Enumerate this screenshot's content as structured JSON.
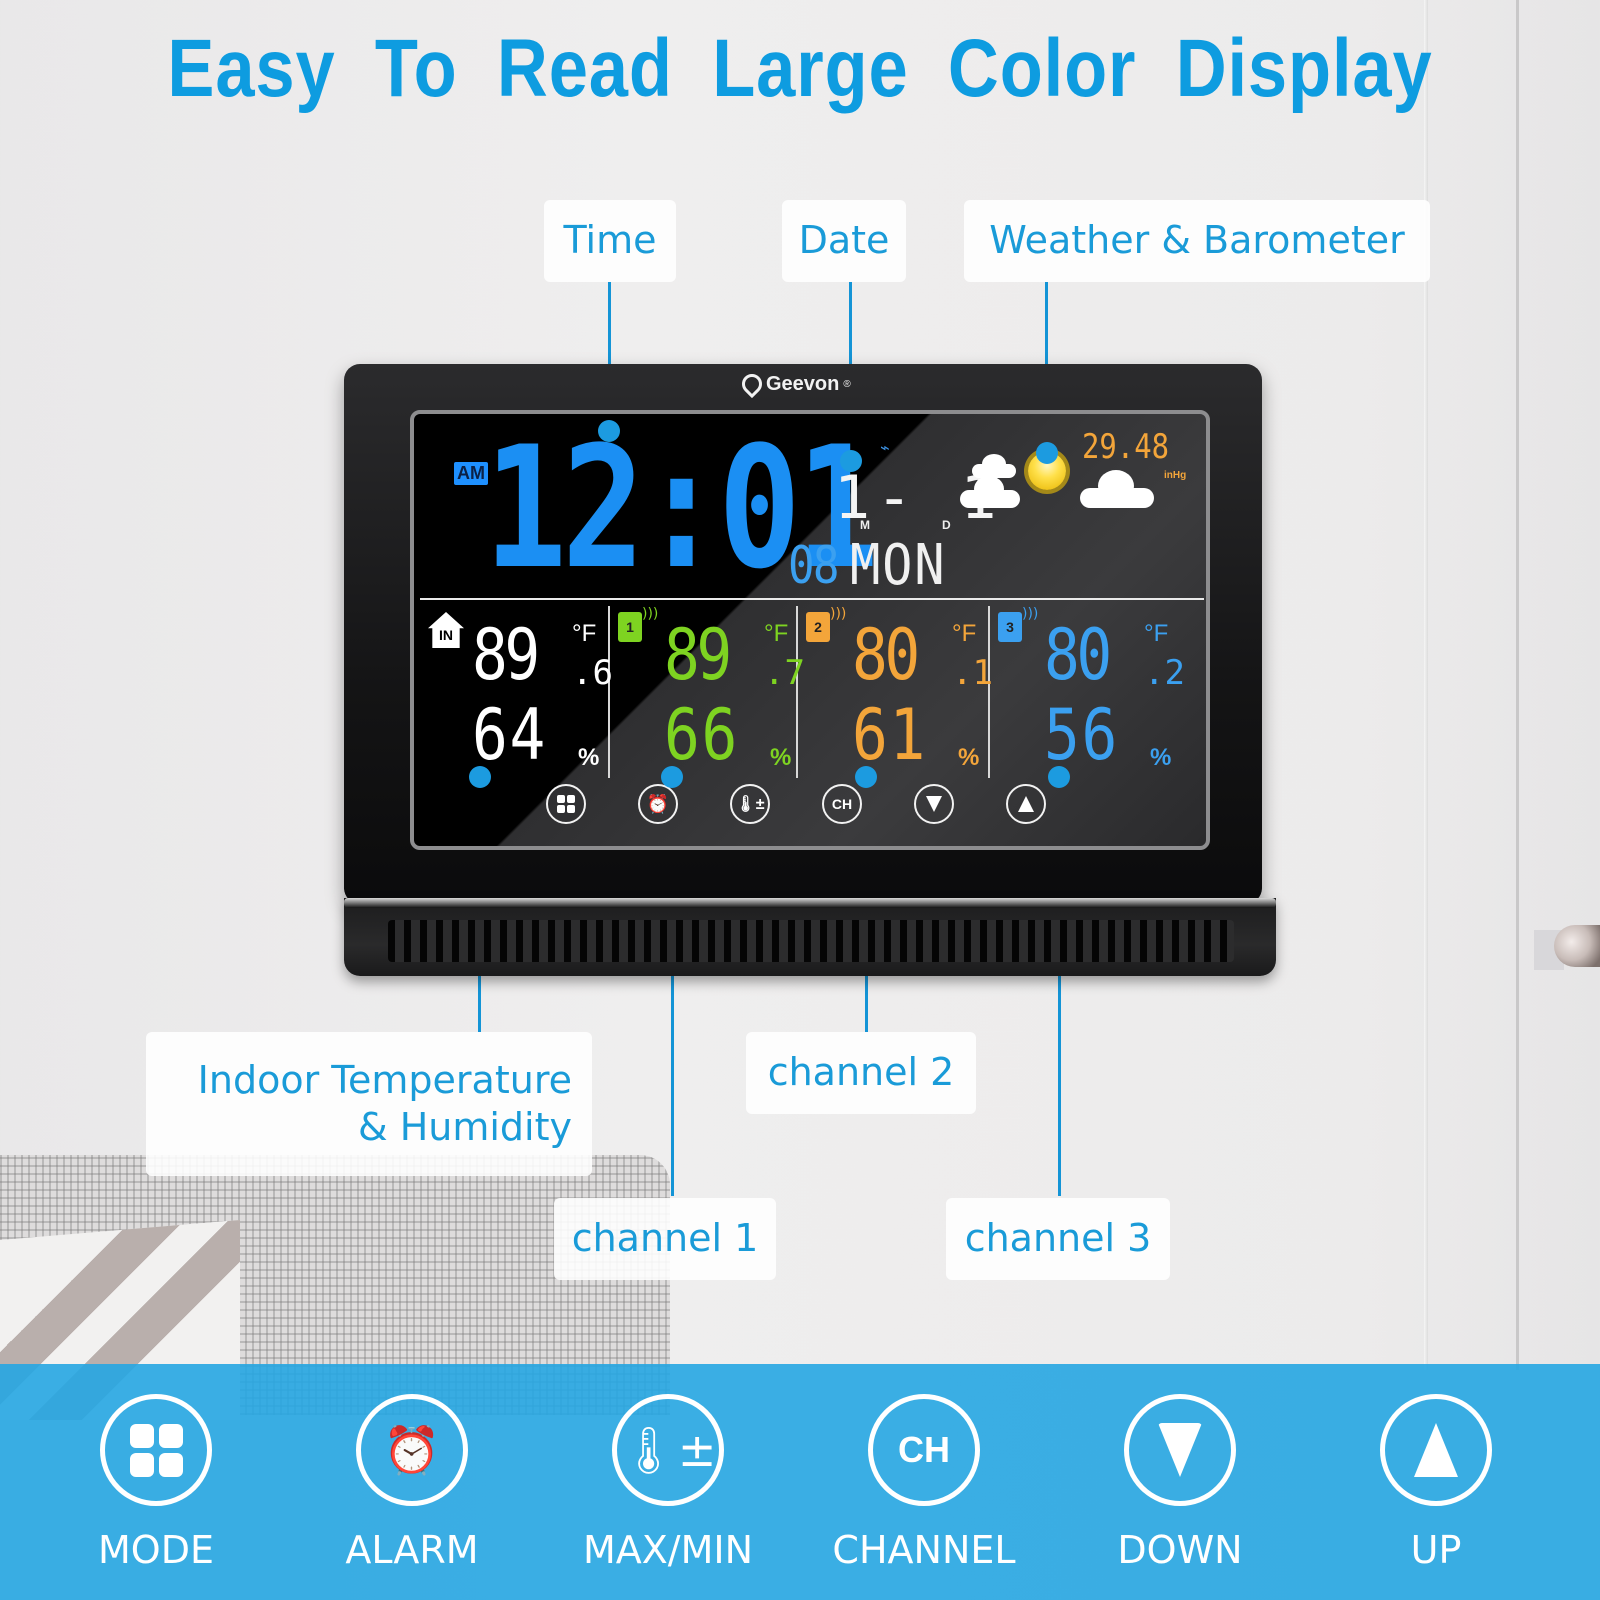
{
  "headline": "Easy To Read Large Color Display",
  "callouts": {
    "time": "Time",
    "date": "Date",
    "weather": "Weather & Barometer",
    "indoor_line1": "Indoor Temperature",
    "indoor_line2": "& Humidity",
    "channel1": "channel 1",
    "channel2": "channel 2",
    "channel3": "channel 3"
  },
  "device": {
    "brand": "Geevon",
    "registered": "®",
    "display": {
      "am_pm": "AM",
      "time": "12:01",
      "date_month_day": "1- 1",
      "month_tag": "M",
      "day_tag": "D",
      "year_suffix": "08",
      "weekday": "MON",
      "forecast_icon": "partly-cloudy-icon",
      "barometer_value": "29.48",
      "barometer_unit": "inHg",
      "panels": [
        {
          "label": "IN",
          "temp": "89",
          "temp_decimal": ".6",
          "temp_unit": "°F",
          "humidity": "64",
          "humidity_unit": "%",
          "color": "#ffffff"
        },
        {
          "label": "1",
          "temp": "89",
          "temp_decimal": ".7",
          "temp_unit": "°F",
          "humidity": "66",
          "humidity_unit": "%",
          "color": "#7ed321"
        },
        {
          "label": "2",
          "temp": "80",
          "temp_decimal": ".1",
          "temp_unit": "°F",
          "humidity": "61",
          "humidity_unit": "%",
          "color": "#f3a53a"
        },
        {
          "label": "3",
          "temp": "80",
          "temp_decimal": ".2",
          "temp_unit": "°F",
          "humidity": "56",
          "humidity_unit": "%",
          "color": "#3ba0f0"
        }
      ],
      "touch_buttons": [
        "mode-icon",
        "alarm-icon",
        "max-min-icon",
        "CH",
        "down-icon",
        "up-icon"
      ]
    }
  },
  "keys": [
    {
      "label": "MODE",
      "icon": "mode-grid-icon"
    },
    {
      "label": "ALARM",
      "icon": "alarm-clock-icon"
    },
    {
      "label": "MAX/MIN",
      "icon": "thermometer-plus-minus-icon"
    },
    {
      "label": "CHANNEL",
      "icon": "ch-icon",
      "icon_text": "CH"
    },
    {
      "label": "DOWN",
      "icon": "triangle-down-icon"
    },
    {
      "label": "UP",
      "icon": "triangle-up-icon"
    }
  ],
  "colors": {
    "accent": "#0e9ce0",
    "bar": "#26a6e2",
    "time_digits": "#1b8ff3",
    "barometer": "#f3a53a"
  }
}
